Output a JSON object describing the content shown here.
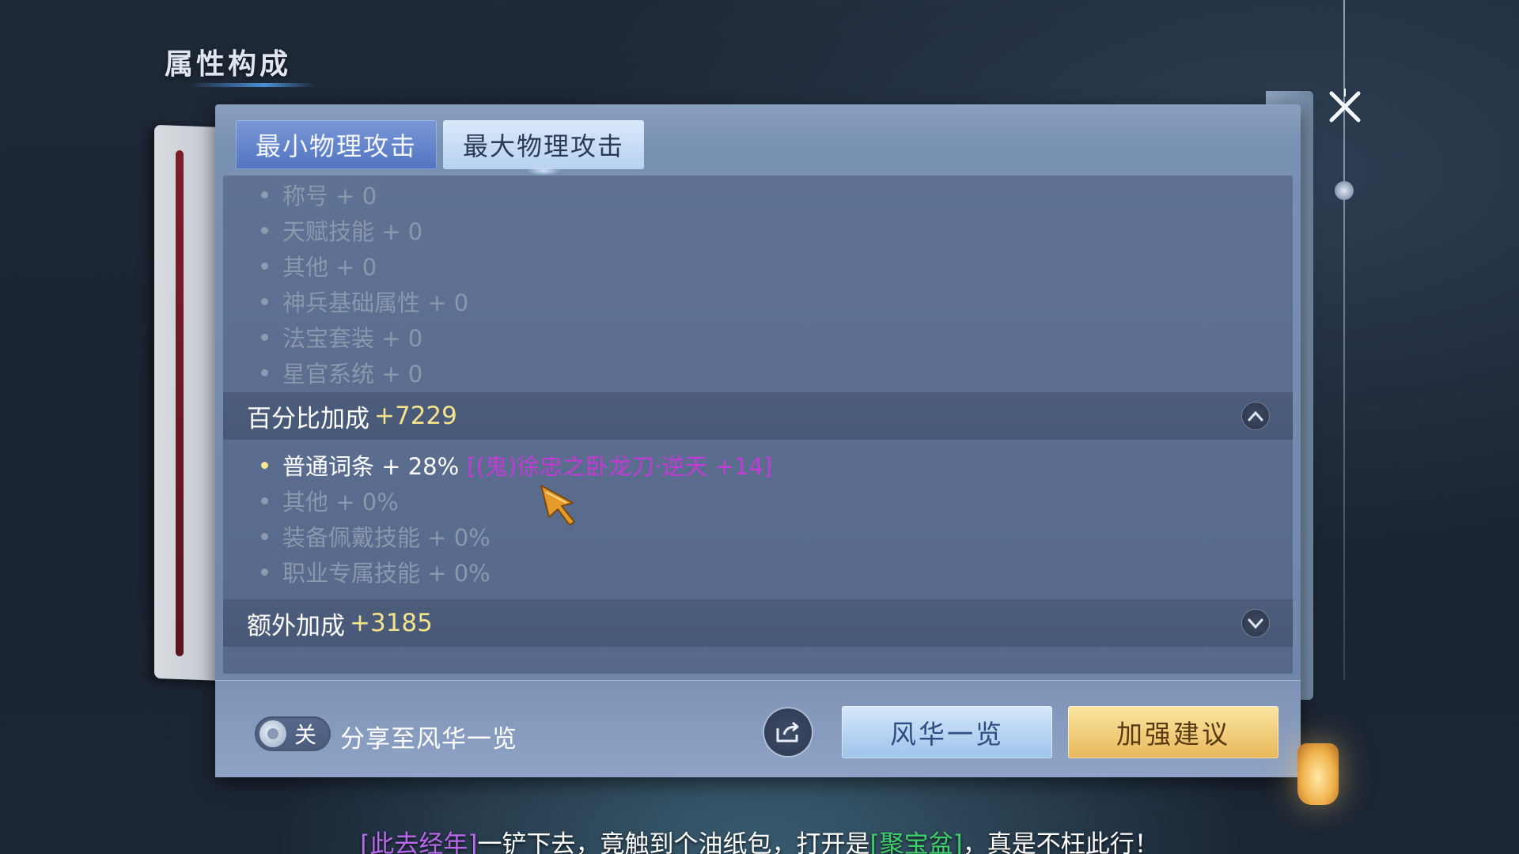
{
  "header": {
    "title": "属性构成"
  },
  "tabs": [
    {
      "label": "最小物理攻击",
      "active": true
    },
    {
      "label": "最大物理攻击",
      "active": false
    }
  ],
  "base_items": [
    {
      "label": "称号 + 0"
    },
    {
      "label": "天赋技能 + 0"
    },
    {
      "label": "其他 + 0"
    },
    {
      "label": "神兵基础属性 + 0"
    },
    {
      "label": "法宝套装 + 0"
    },
    {
      "label": "星官系统 + 0"
    }
  ],
  "percent_section": {
    "label": "百分比加成",
    "value": "+7229",
    "items": [
      {
        "label": "普通词条 + 28%",
        "source": "[(鬼)徐忠之卧龙刀·逆天 +14]",
        "active": true
      },
      {
        "label": "其他 + 0%",
        "active": false
      },
      {
        "label": "装备佩戴技能 + 0%",
        "active": false
      },
      {
        "label": "职业专属技能 + 0%",
        "active": false
      }
    ]
  },
  "extra_section": {
    "label": "额外加成",
    "value": "+3185"
  },
  "footer": {
    "switch_label": "关",
    "switch_on": false,
    "share_label": "分享至风华一览",
    "overview_button": "风华一览",
    "advice_button": "加强建议"
  },
  "caption": {
    "part1": "[此去经年]",
    "part2": "一铲下去，竟触到个油纸包，打开是",
    "part3": "[聚宝盆]",
    "part4": "，真是不枉此行！"
  },
  "colors": {
    "accent_gold": "#f3e48c",
    "source_purple": "#c23bd4",
    "tab_active": "#5274c1",
    "button_gold": "#e8b85a"
  },
  "icons": [
    "close-icon",
    "chevron-up-icon",
    "chevron-down-icon",
    "share-icon",
    "cursor-icon"
  ]
}
